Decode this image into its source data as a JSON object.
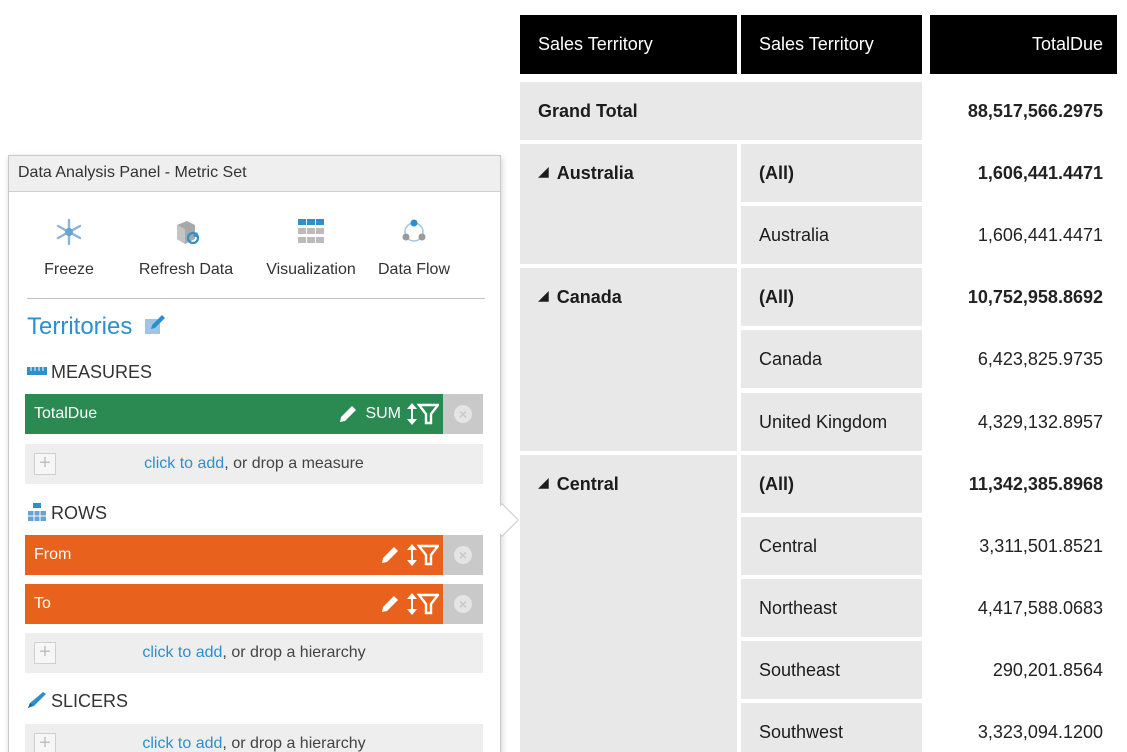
{
  "panel": {
    "title": "Data Analysis Panel - Metric Set",
    "toolbar": [
      {
        "label": "Freeze",
        "icon": "snowflake-icon"
      },
      {
        "label": "Refresh Data",
        "icon": "refresh-data-icon"
      },
      {
        "label": "Visualization",
        "icon": "grid-icon"
      },
      {
        "label": "Data Flow",
        "icon": "data-flow-icon"
      }
    ],
    "metric_title": "Territories",
    "measures": {
      "label": "MEASURES",
      "fields": [
        {
          "name": "TotalDue",
          "aggregation": "SUM"
        }
      ],
      "adder": {
        "link": "click to add",
        "rest": ", or drop a measure"
      }
    },
    "rows": {
      "label": "ROWS",
      "fields": [
        {
          "name": "From"
        },
        {
          "name": "To"
        }
      ],
      "adder": {
        "link": "click to add",
        "rest": ", or drop a hierarchy"
      }
    },
    "slicers": {
      "label": "SLICERS",
      "adder": {
        "link": "click to add",
        "rest": ", or drop a hierarchy"
      }
    },
    "colors": {
      "measure": "#2a8a52",
      "row": "#e8621d",
      "link": "#2c8fce"
    }
  },
  "table": {
    "headers": [
      "Sales Territory",
      "Sales Territory",
      "TotalDue"
    ],
    "grand_total": {
      "label": "Grand Total",
      "value": "88,517,566.2975"
    },
    "groups": [
      {
        "name": "Australia",
        "rows": [
          {
            "label": "(All)",
            "value": "1,606,441.4471"
          },
          {
            "label": "Australia",
            "value": "1,606,441.4471"
          }
        ]
      },
      {
        "name": "Canada",
        "rows": [
          {
            "label": "(All)",
            "value": "10,752,958.8692"
          },
          {
            "label": "Canada",
            "value": "6,423,825.9735"
          },
          {
            "label": "United Kingdom",
            "value": "4,329,132.8957"
          }
        ]
      },
      {
        "name": "Central",
        "rows": [
          {
            "label": "(All)",
            "value": "11,342,385.8968"
          },
          {
            "label": "Central",
            "value": "3,311,501.8521"
          },
          {
            "label": "Northeast",
            "value": "4,417,588.0683"
          },
          {
            "label": "Southeast",
            "value": "290,201.8564"
          },
          {
            "label": "Southwest",
            "value": "3,323,094.1200"
          }
        ]
      }
    ]
  }
}
